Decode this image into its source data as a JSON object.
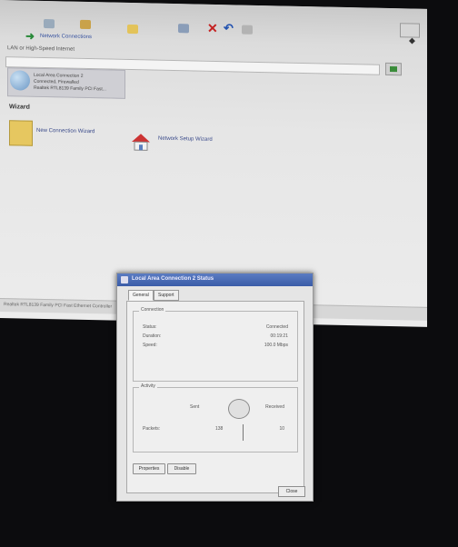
{
  "window": {
    "breadcrumb": "Network Connections",
    "section_header": "LAN or High-Speed Internet",
    "connection": {
      "lines": [
        "Local Area Connection 2",
        "Connected, Firewalled",
        "Realtek RTL8139 Family PCI Fast..."
      ]
    },
    "wizard_header": "Wizard",
    "wizard_items": [
      "New Connection Wizard",
      "Network Setup Wizard"
    ],
    "status_bar": "Realtek RTL8139 Family PCI Fast Ethernet Controller"
  },
  "dialog": {
    "title": "Local Area Connection 2 Status",
    "tabs": [
      "General",
      "Support"
    ],
    "connection_group": "Connection",
    "connection_rows": [
      {
        "label": "Status:",
        "value": "Connected"
      },
      {
        "label": "Duration:",
        "value": "00:19:21"
      },
      {
        "label": "Speed:",
        "value": "100.0 Mbps"
      }
    ],
    "activity_group": "Activity",
    "activity_sent": "Sent",
    "activity_received": "Received",
    "packets_label": "Packets:",
    "packets_sent": "138",
    "packets_received": "10",
    "buttons": {
      "properties": "Properties",
      "disable": "Disable",
      "close": "Close"
    }
  }
}
